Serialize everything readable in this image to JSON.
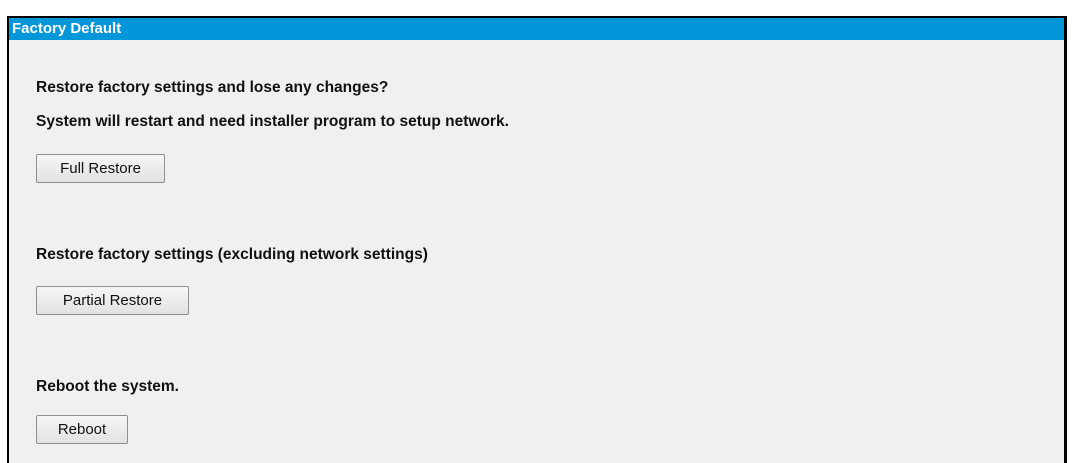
{
  "panel": {
    "title": "Factory Default"
  },
  "full_restore": {
    "prompt": "Restore factory settings and lose any changes?",
    "warning": "System will restart and need installer program to setup network.",
    "button_label": "Full Restore"
  },
  "partial_restore": {
    "prompt": "Restore factory settings (excluding network settings)",
    "button_label": "Partial Restore"
  },
  "reboot": {
    "prompt": "Reboot the system.",
    "button_label": "Reboot"
  },
  "colors": {
    "header_bg": "#0396d9",
    "panel_bg": "#f0f0f0"
  }
}
